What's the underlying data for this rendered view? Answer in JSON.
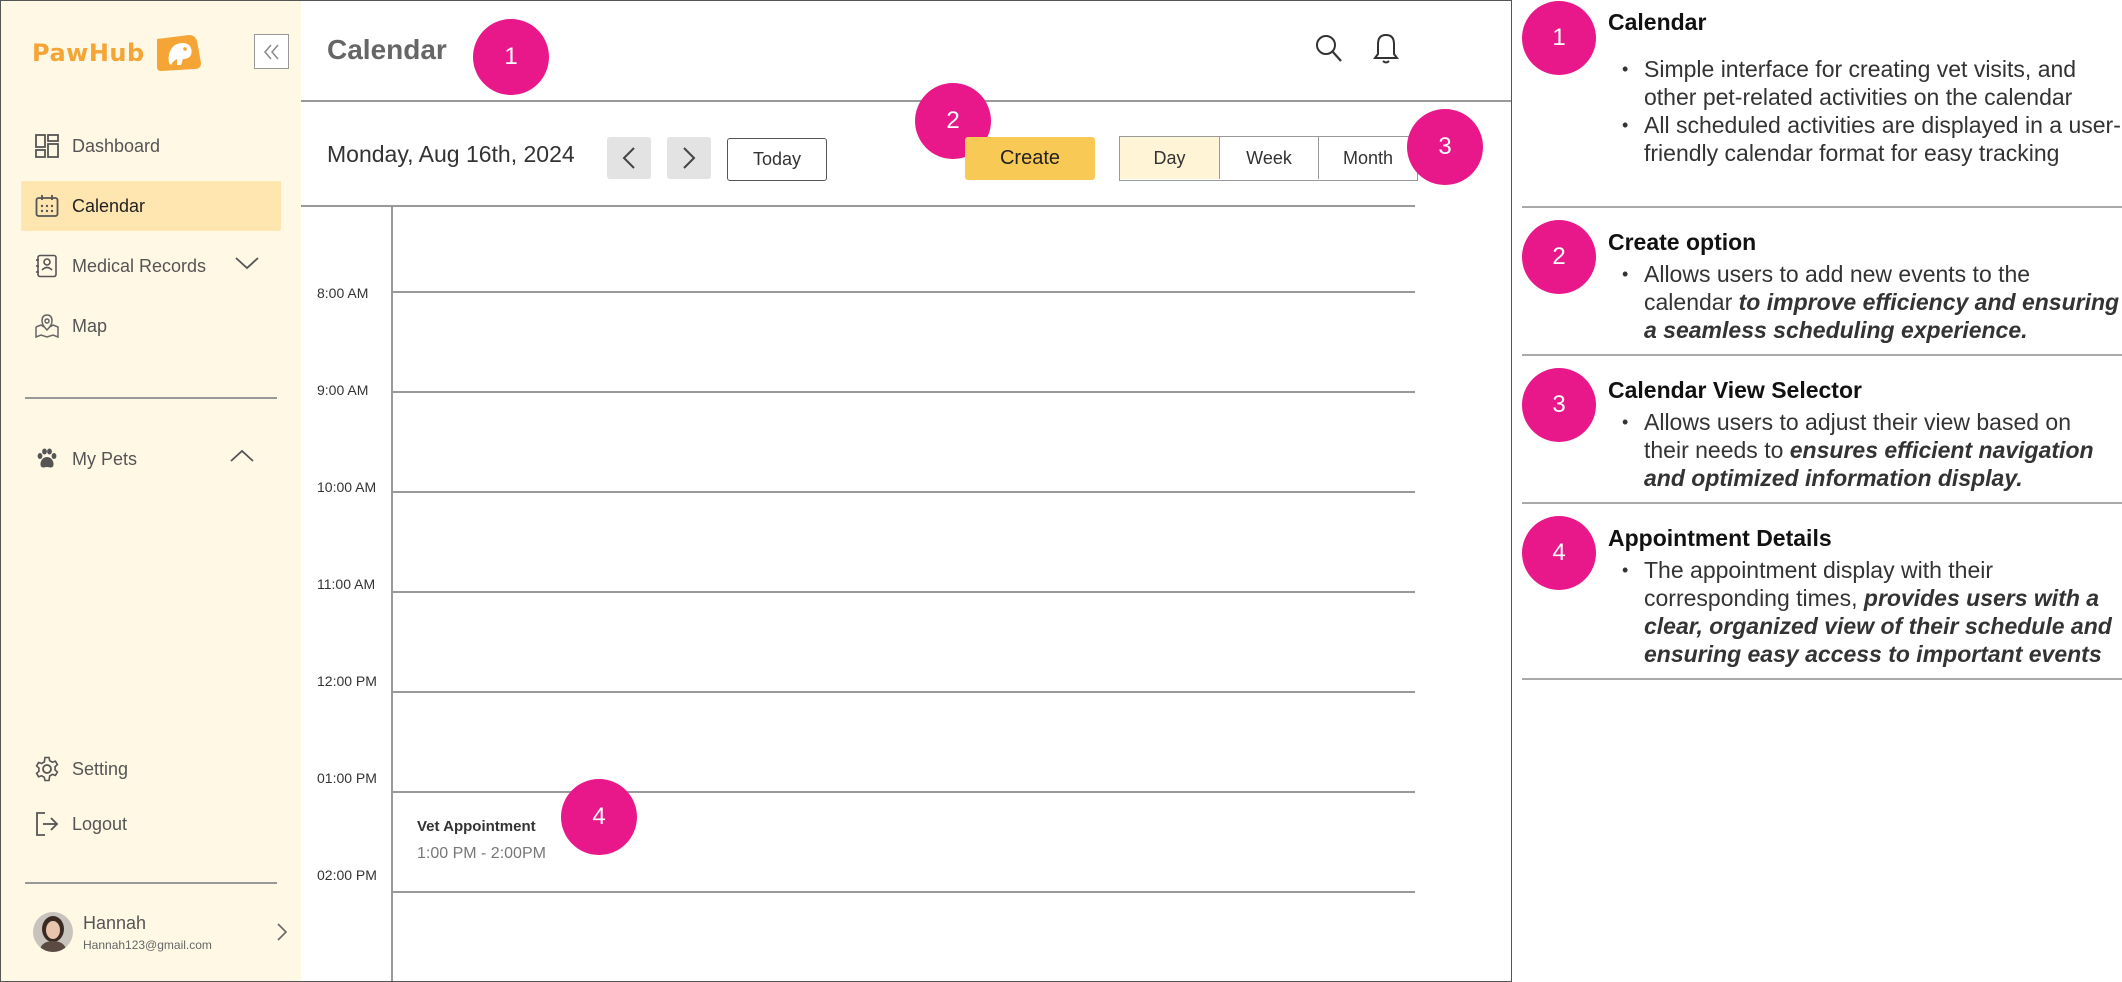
{
  "app": {
    "logo": "PawHub",
    "page_title": "Calendar"
  },
  "sidebar": {
    "items": [
      {
        "label": "Dashboard",
        "icon": "dashboard-icon"
      },
      {
        "label": "Calendar",
        "icon": "calendar-icon",
        "active": true
      },
      {
        "label": "Medical Records",
        "icon": "medical-records-icon"
      },
      {
        "label": "Map",
        "icon": "map-icon"
      }
    ],
    "my_pets": "My Pets",
    "setting": "Setting",
    "logout": "Logout",
    "user": {
      "name": "Hannah",
      "email": "Hannah123@gmail.com"
    }
  },
  "toolbar": {
    "date": "Monday, Aug 16th, 2024",
    "today": "Today",
    "create": "Create",
    "views": [
      "Day",
      "Week",
      "Month"
    ],
    "active_view": "Day"
  },
  "calendar": {
    "hours": [
      "8:00 AM",
      "9:00 AM",
      "10:00 AM",
      "11:00 AM",
      "12:00 PM",
      "01:00 PM",
      "02:00 PM"
    ],
    "event": {
      "title": "Vet Appointment",
      "time": "1:00 PM - 2:00PM"
    }
  },
  "markers": [
    "1",
    "2",
    "3",
    "4"
  ],
  "colors": {
    "accent": "#e8188b",
    "brand": "#f5a536",
    "create": "#f8c955",
    "sidebar": "#fff8e5",
    "active_nav": "#ffe5b0"
  },
  "notes": [
    {
      "num": "1",
      "title": "Calendar",
      "bullets": [
        {
          "text": "Simple interface for creating vet visits, and other pet-related activities on the calendar",
          "em": ""
        },
        {
          "text": "All scheduled activities are displayed in a user-friendly calendar format for easy tracking",
          "em": ""
        }
      ]
    },
    {
      "num": "2",
      "title": "Create option",
      "bullets": [
        {
          "text": "Allows users to add new events to the calendar ",
          "em": "to improve efficiency and ensuring a seamless scheduling experience."
        }
      ]
    },
    {
      "num": "3",
      "title": "Calendar View Selector",
      "bullets": [
        {
          "text": "Allows users to adjust their view based on their needs to ",
          "em": "ensures efficient navigation and optimized information display."
        }
      ]
    },
    {
      "num": "4",
      "title": "Appointment Details",
      "bullets": [
        {
          "text": "The appointment display with their corresponding times, ",
          "em": "provides users with a clear, organized view of their schedule and ensuring easy access to important events"
        }
      ]
    }
  ]
}
